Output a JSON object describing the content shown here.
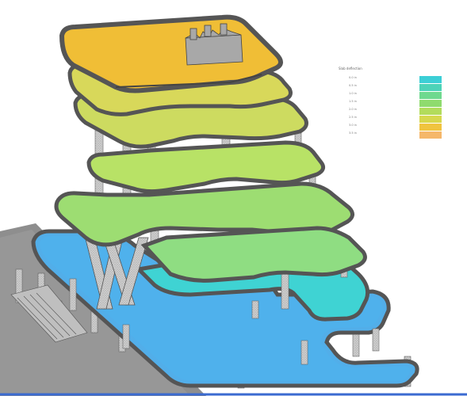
{
  "legend": {
    "title": "Slab deflection",
    "values": [
      "0.0 in",
      "0.5 in",
      "1.0 in",
      "1.5 in",
      "2.0 in",
      "2.5 in",
      "3.0 in",
      "3.5 in"
    ],
    "colors": [
      "#3ccfd6",
      "#4dd3b8",
      "#6fd98f",
      "#8fdb6e",
      "#b2dc5c",
      "#d6d84e",
      "#f0c43f",
      "#f5b76a"
    ]
  },
  "colors": {
    "top_slab": "#f0be36",
    "upper_slab": "#d8d85a",
    "mid_slab": "#b8e266",
    "low_slab": "#8fdd82",
    "teal_slab": "#3fd3d3",
    "podium": "#52aee9",
    "columns": "#c8c8c8",
    "edge_beam": "#555555",
    "ground": "#8e8e8e"
  }
}
